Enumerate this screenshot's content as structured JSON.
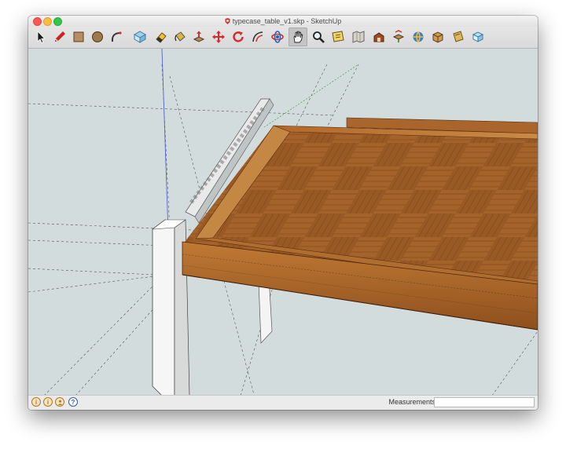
{
  "window": {
    "title": "typecase_table_v1.skp - SketchUp"
  },
  "toolbar": {
    "tools": [
      {
        "name": "select-tool"
      },
      {
        "name": "line-tool"
      },
      {
        "name": "rectangle-tool"
      },
      {
        "name": "circle-tool"
      },
      {
        "name": "arc-tool"
      },
      {
        "name": "make-component-tool"
      },
      {
        "name": "eraser-tool"
      },
      {
        "name": "paint-bucket-tool"
      },
      {
        "name": "push-pull-tool"
      },
      {
        "name": "move-tool"
      },
      {
        "name": "rotate-tool"
      },
      {
        "name": "offset-tool"
      },
      {
        "name": "orbit-tool"
      },
      {
        "name": "pan-tool",
        "active": true
      },
      {
        "name": "zoom-tool"
      },
      {
        "name": "zoom-extents-tool"
      },
      {
        "name": "add-location-tool"
      },
      {
        "name": "3d-warehouse-tool"
      },
      {
        "name": "share-component-tool"
      },
      {
        "name": "get-models-tool"
      },
      {
        "name": "extension-warehouse-tool"
      },
      {
        "name": "layout-tool"
      },
      {
        "name": "send-to-layout-tool"
      }
    ]
  },
  "statusbar": {
    "measurements_label": "Measurements",
    "measurements_value": "",
    "buttons": [
      "geo-location-icon",
      "credits-icon",
      "user-icon",
      "help-icon"
    ],
    "help_glyph": "?",
    "info_glyph": "i"
  },
  "colors": {
    "sky": "#d2dcdc",
    "wood": "#9c5a23",
    "leg": "#f4f4f4",
    "blue_axis": "#5566cc",
    "green_axis": "#4a9a4a"
  }
}
